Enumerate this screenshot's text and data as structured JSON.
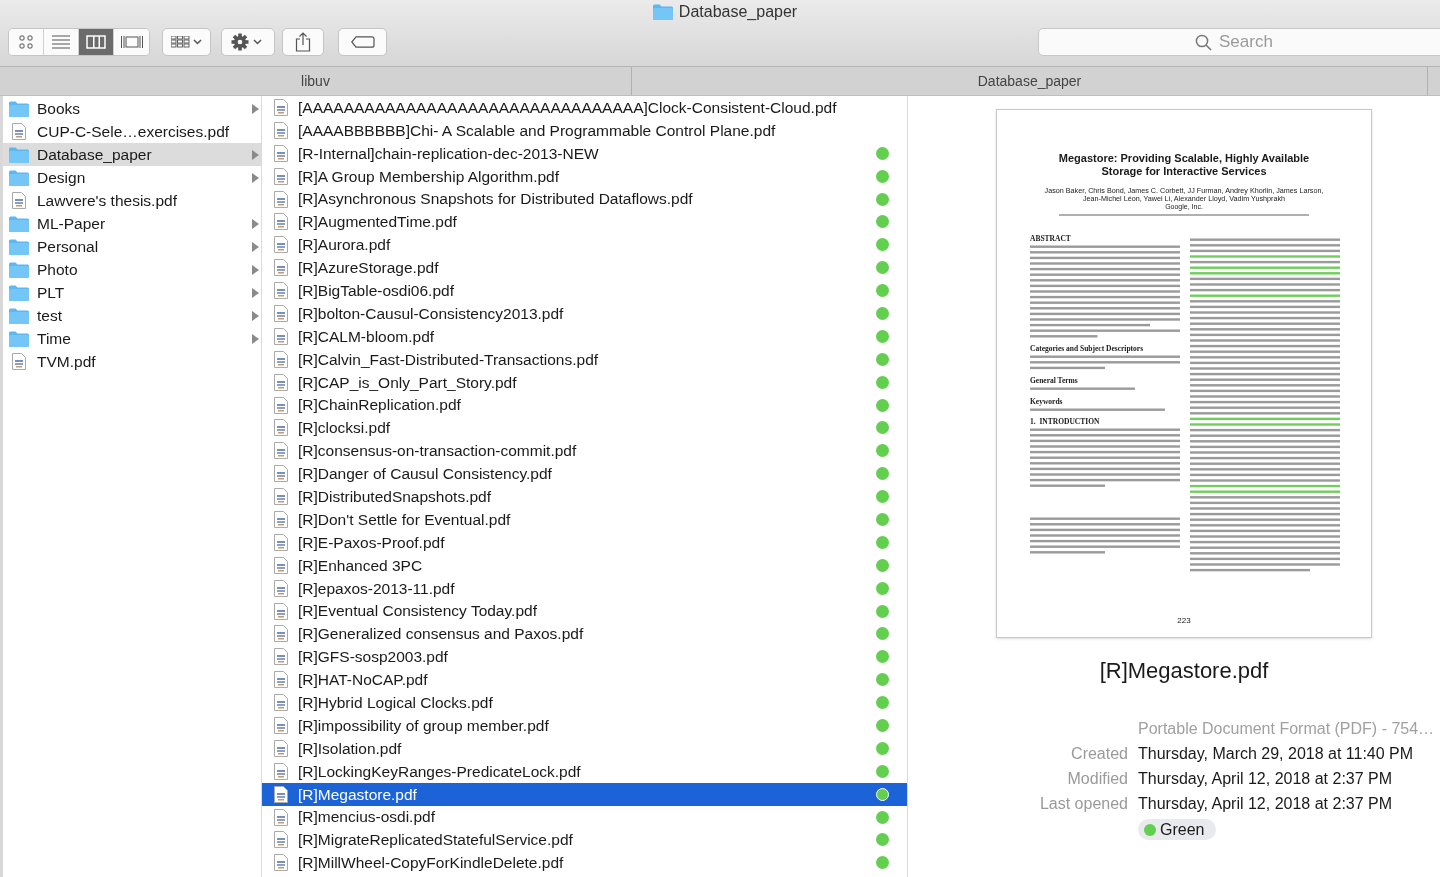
{
  "window": {
    "title": "Database_paper"
  },
  "toolbar": {
    "view_modes": [
      {
        "kind": "icons",
        "selected": false
      },
      {
        "kind": "list",
        "selected": false
      },
      {
        "kind": "columns",
        "selected": true
      },
      {
        "kind": "gallery",
        "selected": false
      }
    ],
    "search": {
      "placeholder": "Search"
    }
  },
  "column_headers": [
    "libuv",
    "Database_paper"
  ],
  "sidebar_column": {
    "items": [
      {
        "name": "Books",
        "kind": "folder",
        "selected": false
      },
      {
        "name": "CUP-C-Sele…exercises.pdf",
        "kind": "pdf",
        "selected": false
      },
      {
        "name": "Database_paper",
        "kind": "folder",
        "selected": true
      },
      {
        "name": "Design",
        "kind": "folder",
        "selected": false
      },
      {
        "name": "Lawvere's thesis.pdf",
        "kind": "pdf",
        "selected": false
      },
      {
        "name": "ML-Paper",
        "kind": "folder",
        "selected": false
      },
      {
        "name": "Personal",
        "kind": "folder",
        "selected": false
      },
      {
        "name": "Photo",
        "kind": "folder",
        "selected": false
      },
      {
        "name": "PLT",
        "kind": "folder",
        "selected": false
      },
      {
        "name": "test",
        "kind": "folder",
        "selected": false
      },
      {
        "name": "Time",
        "kind": "folder",
        "selected": false
      },
      {
        "name": "TVM.pdf",
        "kind": "pdf",
        "selected": false
      }
    ]
  },
  "file_column": {
    "items": [
      {
        "name": "[AAAAAAAAAAAAAAAAAAAAAAAAAAAAAAAAA]Clock-Consistent-Cloud.pdf",
        "selected": false
      },
      {
        "name": "[AAAABBBBBB]Chi- A Scalable and Programmable Control Plane.pdf",
        "selected": false
      },
      {
        "name": "[R-Internal]chain-replication-dec-2013-NEW",
        "selected": false,
        "color": "#62cf4f"
      },
      {
        "name": "[R]A Group Membership Algorithm.pdf",
        "selected": false,
        "color": "#62cf4f"
      },
      {
        "name": "[R]Asynchronous Snapshots for Distributed Dataflows.pdf",
        "selected": false,
        "color": "#62cf4f"
      },
      {
        "name": "[R]AugmentedTime.pdf",
        "selected": false,
        "color": "#62cf4f"
      },
      {
        "name": "[R]Aurora.pdf",
        "selected": false,
        "color": "#62cf4f"
      },
      {
        "name": "[R]AzureStorage.pdf",
        "selected": false,
        "color": "#62cf4f"
      },
      {
        "name": "[R]BigTable-osdi06.pdf",
        "selected": false,
        "color": "#62cf4f"
      },
      {
        "name": "[R]bolton-Causul-Consistency2013.pdf",
        "selected": false,
        "color": "#62cf4f"
      },
      {
        "name": "[R]CALM-bloom.pdf",
        "selected": false,
        "color": "#62cf4f"
      },
      {
        "name": "[R]Calvin_Fast-Distributed-Transactions.pdf",
        "selected": false,
        "color": "#62cf4f"
      },
      {
        "name": "[R]CAP_is_Only_Part_Story.pdf",
        "selected": false,
        "color": "#62cf4f"
      },
      {
        "name": "[R]ChainReplication.pdf",
        "selected": false,
        "color": "#62cf4f"
      },
      {
        "name": "[R]clocksi.pdf",
        "selected": false,
        "color": "#62cf4f"
      },
      {
        "name": "[R]consensus-on-transaction-commit.pdf",
        "selected": false,
        "color": "#62cf4f"
      },
      {
        "name": "[R]Danger of Causul Consistency.pdf",
        "selected": false,
        "color": "#62cf4f"
      },
      {
        "name": "[R]DistributedSnapshots.pdf",
        "selected": false,
        "color": "#62cf4f"
      },
      {
        "name": "[R]Don't Settle for Eventual.pdf",
        "selected": false,
        "color": "#62cf4f"
      },
      {
        "name": "[R]E-Paxos-Proof.pdf",
        "selected": false,
        "color": "#62cf4f"
      },
      {
        "name": "[R]Enhanced 3PC",
        "selected": false,
        "color": "#62cf4f"
      },
      {
        "name": "[R]epaxos-2013-11.pdf",
        "selected": false,
        "color": "#62cf4f"
      },
      {
        "name": "[R]Eventual Consistency Today.pdf",
        "selected": false,
        "color": "#62cf4f"
      },
      {
        "name": "[R]Generalized consensus and Paxos.pdf",
        "selected": false,
        "color": "#62cf4f"
      },
      {
        "name": "[R]GFS-sosp2003.pdf",
        "selected": false,
        "color": "#62cf4f"
      },
      {
        "name": "[R]HAT-NoCAP.pdf",
        "selected": false,
        "color": "#62cf4f"
      },
      {
        "name": "[R]Hybrid Logical Clocks.pdf",
        "selected": false,
        "color": "#62cf4f"
      },
      {
        "name": "[R]impossibility of group member.pdf",
        "selected": false,
        "color": "#62cf4f"
      },
      {
        "name": "[R]Isolation.pdf",
        "selected": false,
        "color": "#62cf4f"
      },
      {
        "name": "[R]LockingKeyRanges-PredicateLock.pdf",
        "selected": false,
        "color": "#62cf4f"
      },
      {
        "name": "[R]Megastore.pdf",
        "selected": true,
        "color": "#62cf4f"
      },
      {
        "name": "[R]mencius-osdi.pdf",
        "selected": false,
        "color": "#62cf4f"
      },
      {
        "name": "[R]MigrateReplicatedStatefulService.pdf",
        "selected": false,
        "color": "#62cf4f"
      },
      {
        "name": "[R]MillWheel-CopyForKindleDelete.pdf",
        "selected": false,
        "color": "#62cf4f"
      }
    ]
  },
  "preview": {
    "document": {
      "title": [
        "Megastore: Providing Scalable, Highly Available",
        "Storage for Interactive Services"
      ],
      "authors": [
        "Jason Baker, Chris Bond, James C. Corbett, JJ Furman, Andrey Khorlin, James Larson,",
        "Jean-Michel Léon, Yawei Li, Alexander Lloyd, Vadim Yushprakh"
      ],
      "affiliation": "Google, Inc.",
      "left_sections": [
        {
          "heading": "ABSTRACT"
        },
        {
          "heading": "Categories and Subject Descriptors"
        },
        {
          "heading": "General Terms"
        },
        {
          "heading": "Keywords"
        },
        {
          "heading": "1.  INTRODUCTION"
        }
      ],
      "page_number": "223"
    },
    "file_name": "[R]Megastore.pdf",
    "kind_text": "Portable Document Format (PDF) - 754…",
    "info": [
      {
        "label": "Created",
        "value": "Thursday, March 29, 2018 at 11:40 PM"
      },
      {
        "label": "Modified",
        "value": "Thursday, April 12, 2018 at 2:37 PM"
      },
      {
        "label": "Last opened",
        "value": "Thursday, April 12, 2018 at 2:37 PM"
      }
    ],
    "tag": {
      "label": "Green",
      "color": "#62cf4f"
    }
  }
}
